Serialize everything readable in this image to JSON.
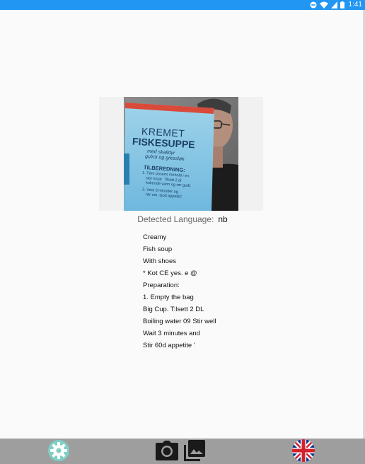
{
  "status_bar": {
    "time": "1:41",
    "icons": [
      "minus-circle-icon",
      "wifi-icon",
      "cellular-icon",
      "battery-icon"
    ],
    "background_color": "#2196f3"
  },
  "image": {
    "bag_title_1": "KREMET",
    "bag_title_2": "FISKESUPPE",
    "bag_subtitle_1": "med skalldyr",
    "bag_subtitle_2": "gulrot og gressløk",
    "bag_heading": "TILBEREDNING:",
    "bag_step_1": "1. Tøm posens innhold i en",
    "bag_step_1b": "stor kopp. Tilsett 2 dl",
    "bag_step_1c": "kokende vann og rør godt.",
    "bag_step_2": "2. Vent 3 minutter og",
    "bag_step_2b": "rør om. God appetitt!"
  },
  "detected": {
    "label": "Detected Language:",
    "value": "nb"
  },
  "translation": {
    "lines": [
      "Creamy",
      "Fish soup",
      "With shoes",
      "* Kot CE yes. e @",
      "Preparation:",
      "1. Empty the bag",
      "Big Cup. T:lsett 2 DL",
      "Boiling water 09 Stir well",
      "Wait 3 minutes and",
      "Stir 60d appetite '"
    ]
  },
  "bottom_bar": {
    "background_color": "#9e9e9e",
    "buttons": [
      "gear-icon",
      "camera-icon",
      "gallery-icon",
      "uk-flag-icon"
    ]
  }
}
